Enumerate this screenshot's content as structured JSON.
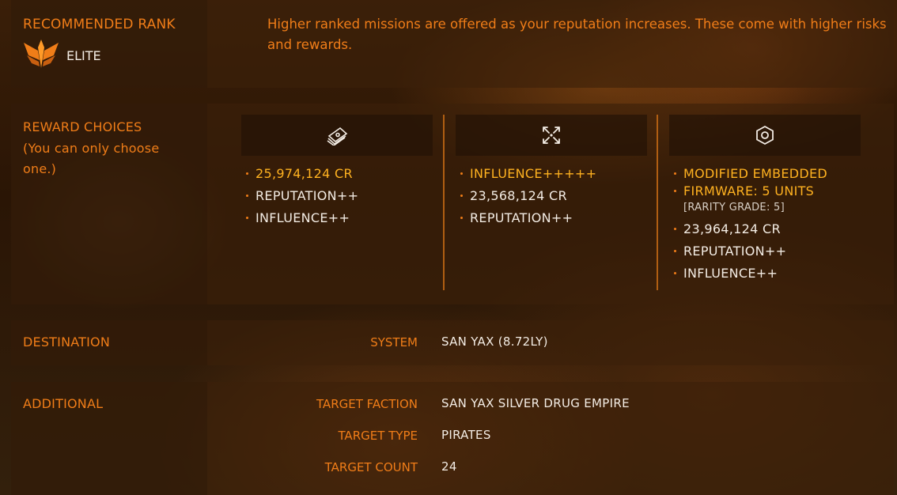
{
  "rank": {
    "label": "RECOMMENDED RANK",
    "value": "ELITE",
    "icon": "elite-rank-icon",
    "description": "Higher ranked missions are offered as your reputation increases. These come with higher risks and rewards."
  },
  "rewards": {
    "label_line1": "REWARD CHOICES",
    "label_line2": "(You can only choose",
    "label_line3": "one.)",
    "choices": [
      {
        "icon": "credits-icon",
        "items": [
          "25,974,124 CR",
          "REPUTATION++",
          "INFLUENCE++"
        ]
      },
      {
        "icon": "influence-icon",
        "items": [
          "INFLUENCE+++++",
          "23,568,124 CR",
          "REPUTATION++"
        ]
      },
      {
        "icon": "material-icon",
        "primary_line1": "MODIFIED EMBEDDED",
        "primary_line2": "FIRMWARE: 5 UNITS",
        "grade": "[RARITY GRADE: 5]",
        "items": [
          "23,964,124 CR",
          "REPUTATION++",
          "INFLUENCE++"
        ]
      }
    ]
  },
  "destination": {
    "label": "DESTINATION",
    "system_key": "SYSTEM",
    "system_value": "SAN YAX (8.72LY)"
  },
  "additional": {
    "label": "ADDITIONAL",
    "rows": [
      {
        "key": "TARGET FACTION",
        "value": "SAN YAX SILVER DRUG EMPIRE"
      },
      {
        "key": "TARGET TYPE",
        "value": "PIRATES"
      },
      {
        "key": "TARGET COUNT",
        "value": "24"
      }
    ]
  },
  "colors": {
    "accent": "#f07d18",
    "highlight": "#ffb220",
    "text": "#f3ece4"
  }
}
